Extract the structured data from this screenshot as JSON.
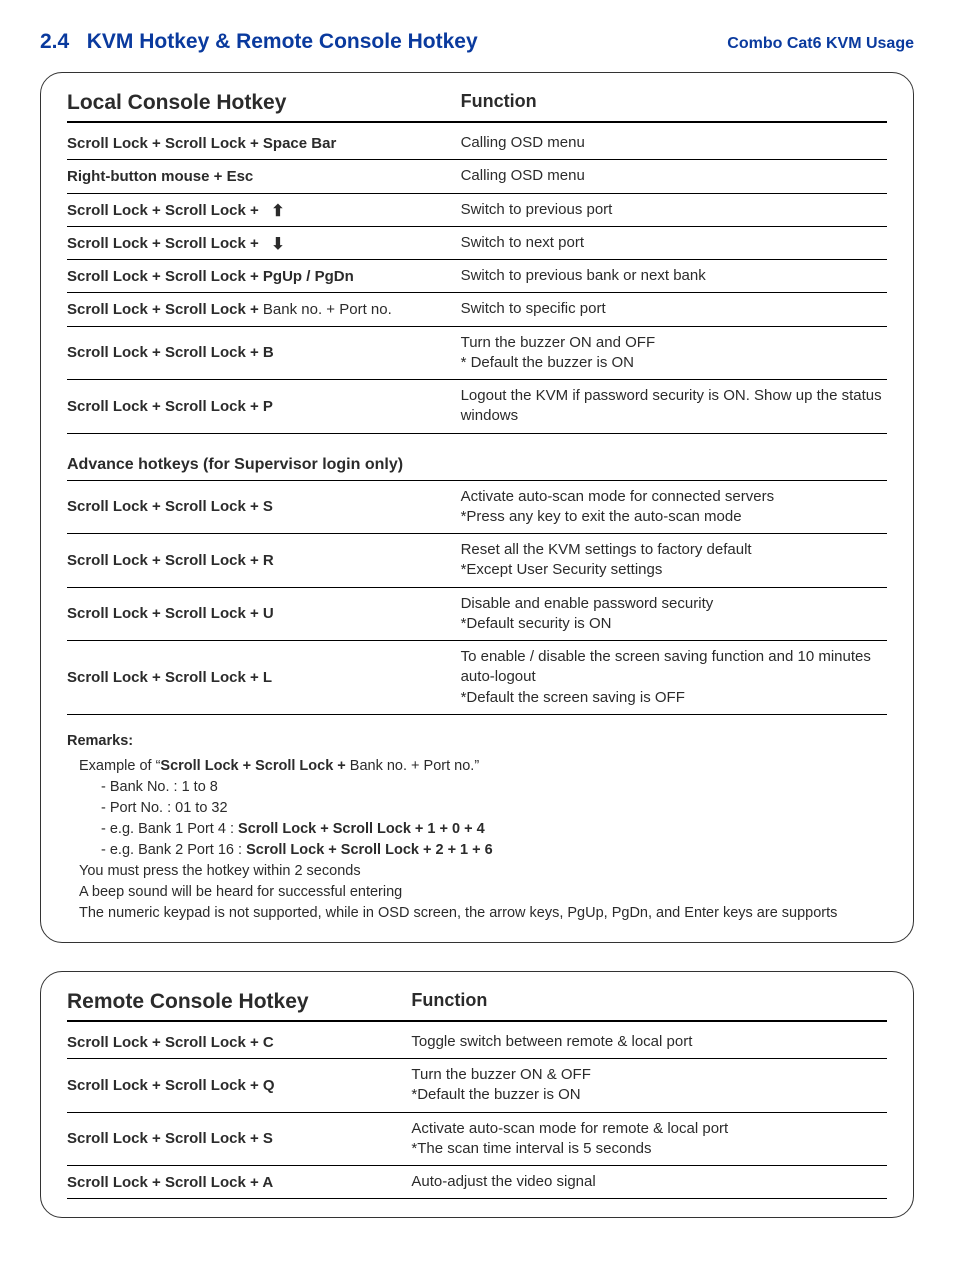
{
  "header": {
    "section": "2.4",
    "title": "KVM Hotkey & Remote Console Hotkey",
    "right": "Combo Cat6 KVM Usage"
  },
  "local": {
    "title": "Local Console Hotkey",
    "funcTitle": "Function",
    "rows": [
      {
        "hk_pre": "Scroll Lock  +  Scroll Lock  +  Space Bar",
        "hk_post": "",
        "func": "Calling OSD menu"
      },
      {
        "hk_pre": "Right-button mouse  +  Esc",
        "hk_post": "",
        "func": "Calling OSD menu"
      },
      {
        "hk_pre": "Scroll Lock  +  Scroll Lock  +",
        "icon": "up",
        "hk_post": "",
        "func": "Switch to previous port"
      },
      {
        "hk_pre": "Scroll Lock  +  Scroll Lock  +",
        "icon": "down",
        "hk_post": "",
        "func": "Switch to next port"
      },
      {
        "hk_pre": "Scroll Lock  +  Scroll Lock  +   PgUp / PgDn",
        "hk_post": "",
        "func": "Switch to previous bank or next bank"
      },
      {
        "hk_pre": "Scroll Lock  +  Scroll Lock  +",
        "hk_post": "   Bank no.  +  Port no.",
        "func": "Switch to specific port"
      },
      {
        "hk_pre": "Scroll Lock  +  Scroll Lock  +   B",
        "hk_post": "",
        "func": "Turn the buzzer ON and OFF\n* Default the buzzer is ON"
      },
      {
        "hk_pre": "Scroll Lock  +  Scroll Lock  +   P",
        "hk_post": "",
        "func": "Logout the KVM if password security is ON.  Show up the status windows"
      }
    ],
    "advTitle": "Advance hotkeys (for Supervisor login only)",
    "advRows": [
      {
        "hk": "Scroll Lock  +  Scroll Lock  +   S",
        "func": "Activate auto-scan mode for connected servers\n*Press any key to exit the auto-scan mode"
      },
      {
        "hk": "Scroll Lock  +  Scroll Lock  +   R",
        "func": "Reset all the KVM settings to factory default\n*Except User Security settings"
      },
      {
        "hk": "Scroll Lock  +  Scroll Lock  +   U",
        "func": "Disable and enable password security\n*Default security is ON"
      },
      {
        "hk": "Scroll Lock  +  Scroll Lock  +   L",
        "func": "To enable / disable the screen saving function and 10 minutes auto-logout\n*Default the screen saving is OFF"
      }
    ],
    "remarks": {
      "title": "Remarks:",
      "line1a": "Example of “",
      "line1b": "Scroll Lock  +  Scroll Lock  +",
      "line1c": "   Bank no.  +  Port no.”",
      "b1": "Bank No. :  1 to 8",
      "b2": "Port No. :  01 to 32",
      "b3a": "e.g. Bank 1 Port 4 :  ",
      "b3b": "Scroll Lock   +   Scroll Lock   +   1   +   0   +   4",
      "b4a": "e.g. Bank 2 Port 16 :  ",
      "b4b": "Scroll Lock   +   Scroll Lock   +   2   +   1   +   6",
      "n1": "You must press the hotkey within 2 seconds",
      "n2": "A beep sound will be heard for successful entering",
      "n3": "The numeric keypad is not supported, while in OSD screen, the arrow keys, PgUp, PgDn, and Enter keys are supports"
    }
  },
  "remote": {
    "title": "Remote Console Hotkey",
    "funcTitle": "Function",
    "rows": [
      {
        "hk": "Scroll Lock  +  Scroll Lock  +   C",
        "func": "Toggle switch between remote & local port"
      },
      {
        "hk": "Scroll Lock  +  Scroll Lock  +   Q",
        "func": "Turn the buzzer ON & OFF\n*Default the buzzer is ON"
      },
      {
        "hk": "Scroll Lock  +  Scroll Lock  +   S",
        "func": "Activate auto-scan mode for remote & local port\n*The scan time interval is 5 seconds"
      },
      {
        "hk": "Scroll Lock  +  Scroll Lock  +   A",
        "func": "Auto-adjust the video signal"
      }
    ]
  }
}
